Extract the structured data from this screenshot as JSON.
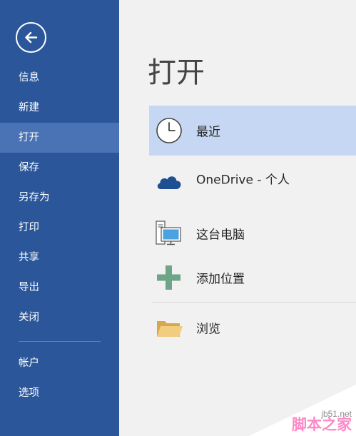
{
  "sidebar": {
    "back_icon": "back-arrow-icon",
    "items": [
      {
        "label": "信息",
        "active": false
      },
      {
        "label": "新建",
        "active": false
      },
      {
        "label": "打开",
        "active": true
      },
      {
        "label": "保存",
        "active": false
      },
      {
        "label": "另存为",
        "active": false
      },
      {
        "label": "打印",
        "active": false
      },
      {
        "label": "共享",
        "active": false
      },
      {
        "label": "导出",
        "active": false
      },
      {
        "label": "关闭",
        "active": false
      }
    ],
    "bottom_items": [
      {
        "label": "帐户"
      },
      {
        "label": "选项"
      }
    ]
  },
  "main": {
    "title": "打开",
    "locations": [
      {
        "label": "最近",
        "icon": "clock-icon",
        "selected": true
      },
      {
        "label": "OneDrive - 个人",
        "icon": "cloud-icon",
        "selected": false
      },
      {
        "label": "这台电脑",
        "icon": "computer-icon",
        "selected": false
      },
      {
        "label": "添加位置",
        "icon": "plus-icon",
        "selected": false
      },
      {
        "label": "浏览",
        "icon": "folder-icon",
        "selected": false
      }
    ]
  },
  "watermark": {
    "site": "jb51.net",
    "name": "脚本之家"
  },
  "colors": {
    "sidebar": "#2b579a",
    "sidebar_active": "#4a73b6",
    "selected_row": "#c5d7f2",
    "background": "#f1f1f1"
  }
}
